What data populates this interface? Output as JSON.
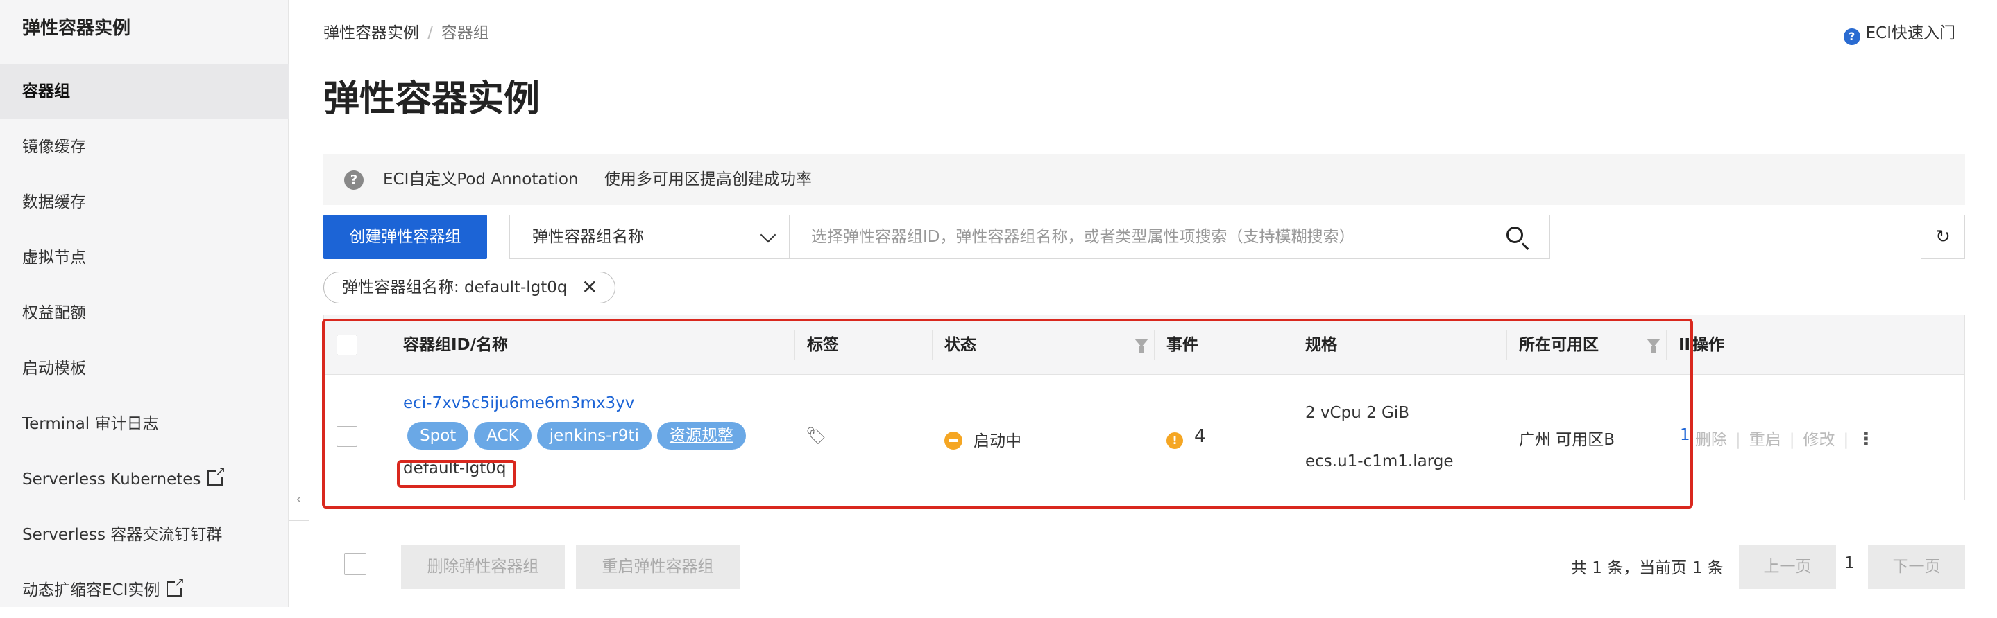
{
  "sidebar": {
    "title": "弹性容器实例",
    "items": [
      {
        "label": "容器组",
        "active": true,
        "external": false
      },
      {
        "label": "镜像缓存",
        "active": false,
        "external": false
      },
      {
        "label": "数据缓存",
        "active": false,
        "external": false
      },
      {
        "label": "虚拟节点",
        "active": false,
        "external": false
      },
      {
        "label": "权益配额",
        "active": false,
        "external": false
      },
      {
        "label": "启动模板",
        "active": false,
        "external": false
      },
      {
        "label": "Terminal 审计日志",
        "active": false,
        "external": false
      },
      {
        "label": "Serverless Kubernetes",
        "active": false,
        "external": true
      },
      {
        "label": "Serverless 容器交流钉钉群",
        "active": false,
        "external": false
      },
      {
        "label": "动态扩缩容ECI实例",
        "active": false,
        "external": true
      }
    ],
    "collapse_glyph": "‹"
  },
  "breadcrumb": {
    "root": "弹性容器实例",
    "sep": "/",
    "current": "容器组"
  },
  "help": {
    "icon": "?",
    "label": "ECI快速入门"
  },
  "page_title": "弹性容器实例",
  "notice": {
    "icon": "?",
    "link1": "ECI自定义Pod Annotation",
    "link2": "使用多可用区提高创建成功率"
  },
  "toolbar": {
    "create_label": "创建弹性容器组",
    "select_value": "弹性容器组名称",
    "search_placeholder": "选择弹性容器组ID，弹性容器组名称，或者类型属性项搜索（支持模糊搜索）",
    "refresh_glyph": "↻"
  },
  "filter": {
    "label": "弹性容器组名称: default-lgt0q",
    "close_glyph": "✕"
  },
  "table": {
    "headers": {
      "id_name": "容器组ID/名称",
      "tags": "标签",
      "status": "状态",
      "events": "事件",
      "spec": "规格",
      "zone": "所在可用区",
      "ip_trunc": "II",
      "actions": "操作"
    },
    "rows": [
      {
        "id": "eci-7xv5c5iju6me6m3mx3yv",
        "tags": [
          "Spot",
          "ACK",
          "jenkins-r9ti"
        ],
        "tag_link": "资源规整",
        "name": "default-lgt0q",
        "status": "启动中",
        "events": "4",
        "spec_line1": "2 vCpu 2 GiB",
        "spec_line2": "ecs.u1-c1m1.large",
        "zone": "广州 可用区B",
        "ip_trunc": "1",
        "action_delete": "删除",
        "action_restart": "重启",
        "action_edit": "修改",
        "action_more": "⋮"
      }
    ]
  },
  "footer": {
    "delete_label": "删除弹性容器组",
    "restart_label": "重启弹性容器组",
    "total_text": "共 1 条，当前页 1 条",
    "prev_label": "上一页",
    "page_number": "1",
    "next_label": "下一页"
  },
  "colors": {
    "primary": "#1c64d6",
    "tag": "#6aa8e6",
    "warning": "#f5a623",
    "highlight": "#d9281e"
  }
}
